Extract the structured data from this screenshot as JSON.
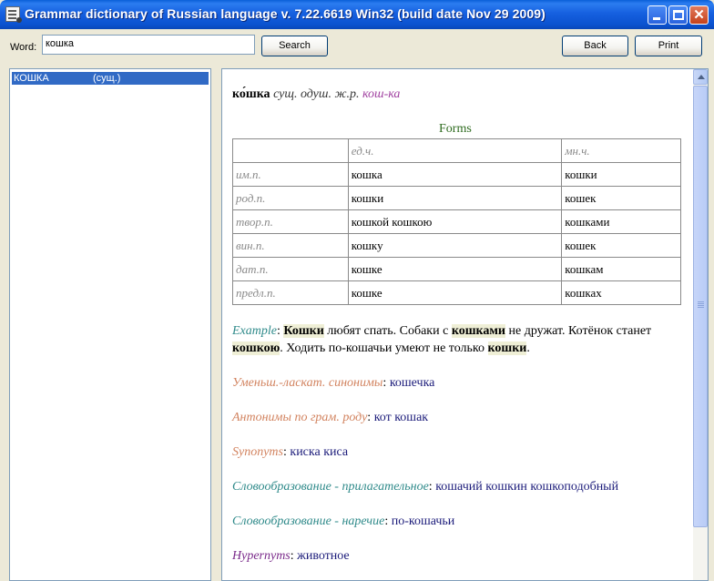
{
  "window": {
    "title": "Grammar dictionary of Russian language v. 7.22.6619  Win32  (build date Nov 29 2009)"
  },
  "toolbar": {
    "word_label": "Word:",
    "search_value": "кошка",
    "search_label": "Search",
    "back_label": "Back",
    "print_label": "Print"
  },
  "results": [
    {
      "word": "КОШКА",
      "pos": "(сущ.)"
    }
  ],
  "article": {
    "headword": "ко́шка",
    "grammar": "сущ. одуш. ж.р.",
    "syllables": "кош-ка",
    "forms_title": "Forms",
    "forms_header": [
      "",
      "ед.ч.",
      "мн.ч."
    ],
    "forms_rows": [
      [
        "им.п.",
        "кошка",
        "кошки"
      ],
      [
        "род.п.",
        "кошки",
        "кошек"
      ],
      [
        "твор.п.",
        "кошкой  кошкою",
        "кошками"
      ],
      [
        "вин.п.",
        "кошку",
        "кошек"
      ],
      [
        "дат.п.",
        "кошке",
        "кошкам"
      ],
      [
        "предл.п.",
        "кошке",
        "кошках"
      ]
    ],
    "example": {
      "label": "Example",
      "w1": "Кошки",
      "t1": " любят спать. Собаки с ",
      "w2": "кошками",
      "t2": " не дружат. Котёнок станет ",
      "w3": "кошкою",
      "t3": ". Ходить по-кошачьи умеют не только ",
      "w4": "кошки",
      "t4": "."
    },
    "diminutive": {
      "label": "Уменьш.-ласкат. синонимы",
      "value": "кошечка"
    },
    "antonyms": {
      "label": "Антонимы по грам. роду",
      "value": "кот кошак"
    },
    "synonyms": {
      "label": "Synonyms",
      "value": "киска киса"
    },
    "adjectives": {
      "label": "Словообразование - прилагательное",
      "value": "кошачий кошкин кошкоподобный"
    },
    "adverbs": {
      "label": "Словообразование - наречие",
      "value": "по-кошачьи"
    },
    "hypernyms": {
      "label": "Hypernyms",
      "value": "животное"
    }
  },
  "icons": [
    "app-icon",
    "minimize-icon",
    "maximize-icon",
    "close-icon",
    "scroll-up-arrow-icon"
  ],
  "colors": {
    "titlebar": "#0b52cf",
    "selection": "#316ac5",
    "forms_title": "#2e6b1f",
    "label_teal": "#2f8a8a",
    "label_orange": "#d2835f",
    "label_purple": "#7a2a8a",
    "value_navy": "#1b1b7a"
  }
}
